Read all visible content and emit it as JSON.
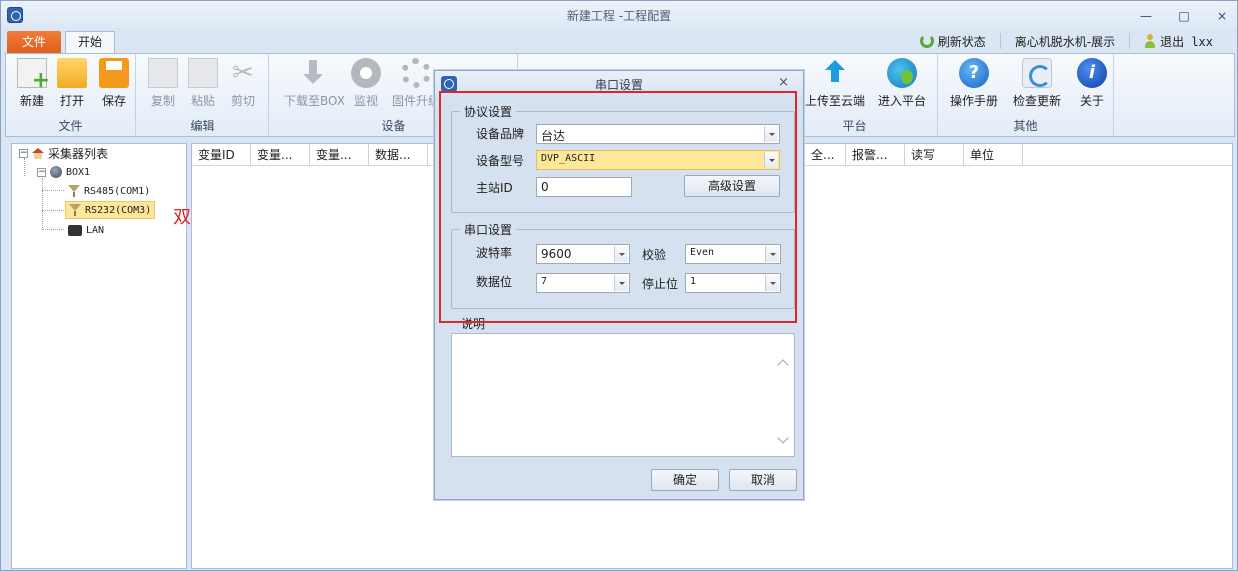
{
  "window": {
    "title": "新建工程 -工程配置",
    "minimize": "—",
    "maximize": "□",
    "close": "×"
  },
  "tabs": {
    "file": "文件",
    "start": "开始"
  },
  "top_right": {
    "refresh": "刷新状态",
    "project": "离心机脱水机-展示",
    "logout": "退出 lxx"
  },
  "ribbon": {
    "groups": {
      "file": "文件",
      "edit": "编辑",
      "device": "设备",
      "platform": "平台",
      "other": "其他"
    },
    "buttons": {
      "new": "新建",
      "open": "打开",
      "save": "保存",
      "copy": "复制",
      "paste": "粘贴",
      "cut": "剪切",
      "download": "下载至BOX",
      "monitor": "监视",
      "firmware": "固件升级",
      "upload": "上传至云端",
      "enter_platform": "进入平台",
      "manual": "操作手册",
      "check_update": "检查更新",
      "about": "关于"
    }
  },
  "tree": {
    "root": "采集器列表",
    "box": "BOX1",
    "rs485": "RS485(COM1)",
    "rs232": "RS232(COM3)",
    "lan": "LAN"
  },
  "annotation": "双击",
  "grid": {
    "columns": [
      "变量ID",
      "变量...",
      "变量...",
      "数据...",
      "全...",
      "报警...",
      "读写",
      "单位"
    ]
  },
  "dialog": {
    "title": "串口设置",
    "close": "×",
    "protocol": {
      "legend": "协议设置",
      "brand_label": "设备品牌",
      "brand_value": "台达",
      "model_label": "设备型号",
      "model_value": "DVP_ASCII",
      "station_label": "主站ID",
      "station_value": "0",
      "advanced_button": "高级设置"
    },
    "serial": {
      "legend": "串口设置",
      "baud_label": "波特率",
      "baud_value": "9600",
      "parity_label": "校验",
      "parity_value": "Even",
      "databits_label": "数据位",
      "databits_value": "7",
      "stopbits_label": "停止位",
      "stopbits_value": "1"
    },
    "description_label": "说明",
    "ok": "确定",
    "cancel": "取消"
  },
  "colors": {
    "accent_orange": "#e05e1b",
    "highlight_red": "#e0262a",
    "selection_yellow": "#fde79a"
  }
}
